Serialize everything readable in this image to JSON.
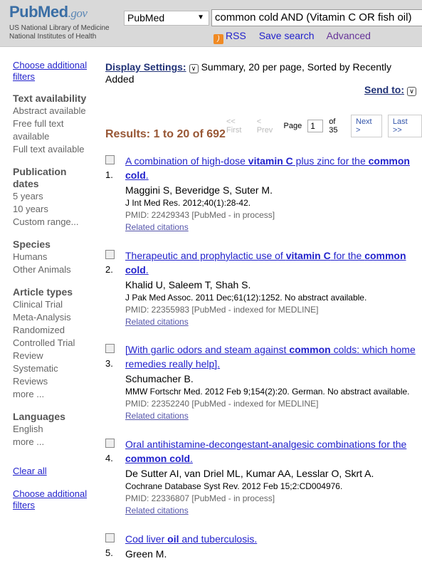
{
  "header": {
    "logo": "PubMed",
    "logo_suffix": ".gov",
    "org1": "US National Library of Medicine",
    "org2": "National Institutes of Health",
    "database": "PubMed",
    "search_value": "common cold AND (Vitamin C OR fish oil)",
    "links": [
      "RSS",
      "Save search",
      "Advanced"
    ]
  },
  "sidebar": {
    "choose_top": "Choose additional filters",
    "groups": [
      {
        "heading": "Text availability",
        "items": [
          "Abstract available",
          "Free full text available",
          "Full text available"
        ]
      },
      {
        "heading": "Publication dates",
        "items": [
          "5 years",
          "10 years",
          "Custom range..."
        ]
      },
      {
        "heading": "Species",
        "items": [
          "Humans",
          "Other Animals"
        ]
      },
      {
        "heading": "Article types",
        "items": [
          "Clinical Trial",
          "Meta-Analysis",
          "Randomized Controlled Trial",
          "Review",
          "Systematic Reviews",
          "more ..."
        ]
      },
      {
        "heading": "Languages",
        "items": [
          "English",
          "more ..."
        ]
      }
    ],
    "clear_all": "Clear all",
    "choose_bottom": "Choose additional filters"
  },
  "display": {
    "label": "Display Settings:",
    "value": "Summary, 20 per page, Sorted by Recently Added",
    "send_to": "Send to:"
  },
  "pager": {
    "first": "<< First",
    "prev": "< Prev",
    "page_label": "Page",
    "page": "1",
    "of": "of 35",
    "next": "Next >",
    "last": "Last >>"
  },
  "results_count": "Results: 1 to 20 of 692",
  "results": [
    {
      "num": "1.",
      "title": [
        [
          "A combination of high-dose ",
          0
        ],
        [
          "vitamin C",
          1
        ],
        [
          " plus zinc for the ",
          0
        ],
        [
          "common cold",
          1
        ],
        [
          ".",
          0
        ]
      ],
      "authors": "Maggini S, Beveridge S, Suter M.",
      "journal": "J Int Med Res. 2012;40(1):28-42.",
      "pmid": "PMID: 22429343 [PubMed - in process]",
      "related": "Related citations"
    },
    {
      "num": "2.",
      "title": [
        [
          "Therapeutic and prophylactic use of ",
          0
        ],
        [
          "vitamin C",
          1
        ],
        [
          " for the ",
          0
        ],
        [
          "common cold",
          1
        ],
        [
          ".",
          0
        ]
      ],
      "authors": "Khalid U, Saleem T, Shah S.",
      "journal": "J Pak Med Assoc. 2011 Dec;61(12):1252. No abstract available.",
      "pmid": "PMID: 22355983 [PubMed - indexed for MEDLINE]",
      "related": "Related citations"
    },
    {
      "num": "3.",
      "title": [
        [
          "[With garlic odors and steam against ",
          0
        ],
        [
          "common",
          1
        ],
        [
          " colds: which home remedies really help].",
          0
        ]
      ],
      "authors": "Schumacher B.",
      "journal": "MMW Fortschr Med. 2012 Feb 9;154(2):20. German. No abstract available.",
      "pmid": "PMID: 22352240 [PubMed - indexed for MEDLINE]",
      "related": "Related citations"
    },
    {
      "num": "4.",
      "title": [
        [
          "Oral antihistamine-decongestant-analgesic combinations for the ",
          0
        ],
        [
          "common cold",
          1
        ],
        [
          ".",
          0
        ]
      ],
      "authors": "De Sutter AI, van Driel ML, Kumar AA, Lesslar O, Skrt A.",
      "journal": "Cochrane Database Syst Rev. 2012 Feb 15;2:CD004976.",
      "pmid": "PMID: 22336807 [PubMed - in process]",
      "related": "Related citations"
    },
    {
      "num": "5.",
      "title": [
        [
          "Cod liver ",
          0
        ],
        [
          "oil",
          1
        ],
        [
          " and tuberculosis.",
          0
        ]
      ],
      "authors": "Green M."
    }
  ]
}
